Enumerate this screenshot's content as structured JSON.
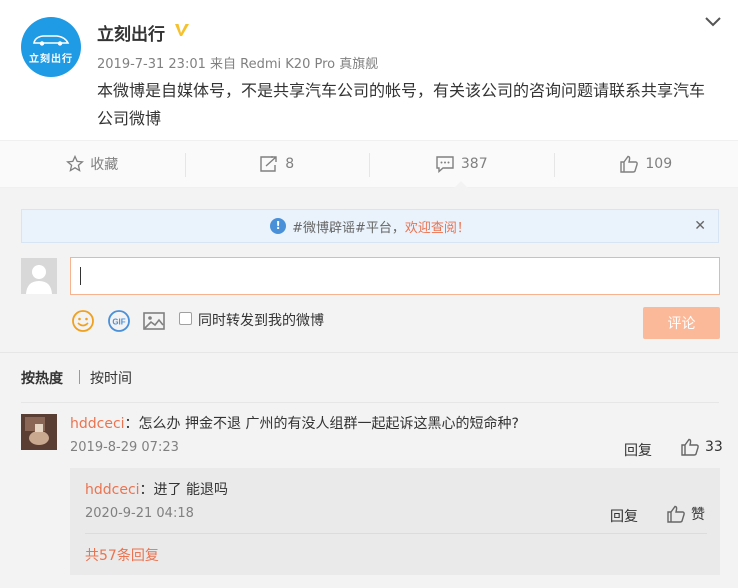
{
  "post": {
    "username": "立刻出行",
    "avatar_text": "立刻出行",
    "verified_icon": "verified-v-badge",
    "time": "2019-7-31 23:01",
    "source_prefix": "来自",
    "source": "Redmi K20 Pro 真旗舰",
    "text": "本微博是自媒体号，不是共享汽车公司的帐号，有关该公司的咨询问题请联系共享汽车公司微博",
    "menu_icon": "chevron-down-icon"
  },
  "actions": {
    "favorite_label": "收藏",
    "repost_count": "8",
    "comment_count": "387",
    "like_count": "109"
  },
  "notice": {
    "icon_glyph": "!",
    "prefix": "#微博辟谣#平台，",
    "highlight": "欢迎查阅！",
    "close_glyph": "✕"
  },
  "composer": {
    "input_value": "",
    "repost_label": "同时转发到我的微博",
    "submit_label": "评论",
    "tools": [
      "emoji-icon",
      "gif-icon",
      "image-icon"
    ]
  },
  "sort": {
    "hot": "按热度",
    "time": "按时间"
  },
  "comment": {
    "user": "hddceci",
    "text": "：怎么办 押金不退 广州的有没人组群一起起诉这黑心的短命种?",
    "time": "2019-8-29 07:23",
    "reply_label": "回复",
    "likes": "33",
    "reply": {
      "user": "hddceci",
      "text": "：进了 能退吗",
      "time": "2020-9-21 04:18",
      "reply_label": "回复",
      "like_label": "赞"
    },
    "more_replies": "共57条回复"
  },
  "colors": {
    "accent": "#eb7350",
    "brand_blue": "#1f9ae4",
    "submit_disabled": "#fcb99a",
    "verified_gold": "#f6c12b"
  }
}
